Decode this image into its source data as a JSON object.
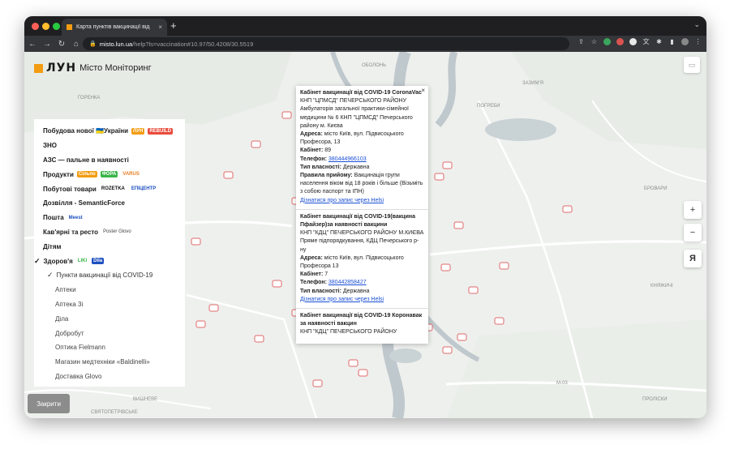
{
  "browser": {
    "tab_title": "Карта пунктів вакцинації від",
    "tab_close": "×",
    "new_tab": "+",
    "url_host": "misto.lun.ua",
    "url_path": "/help?ls=vaccination#10.97/50.4208/30.5519"
  },
  "brand": {
    "lun": "ЛУН",
    "name": "Місто Моніторинг"
  },
  "map_labels": {
    "horenka": "ГОРЕНКА",
    "obolon": "ОБОЛОНЬ",
    "zazymia": "ЗАЗИМ'Я",
    "pohreby": "ПОГРЕБИ",
    "brovary": "БРОВАРИ",
    "kniazhychi": "КНЯЖИЧІ",
    "vyshneve": "ВИШНЕВЕ",
    "sviatopetrivske": "СВЯТОПЕТРІВСЬКЕ",
    "proliski": "ПРОЛІСКИ",
    "m03": "М-03"
  },
  "menu": {
    "items": [
      {
        "label": "Побудова нової 🇺🇦України",
        "extra": "ЛУН"
      },
      {
        "label": "ЗНО"
      },
      {
        "label": "АЗС — пальне в наявності"
      },
      {
        "label": "Продукти",
        "extra": "VARUS"
      },
      {
        "label": "Побутові товари",
        "extra": "ROZETKA"
      },
      {
        "label": "Дозвілля - SemanticForce"
      },
      {
        "label": "Пошта"
      },
      {
        "label": "Кав'ярні та ресто",
        "extra": "Poster Glovo"
      },
      {
        "label": "Дітям"
      },
      {
        "label": "Здоров'я"
      }
    ],
    "selected_sub": "Пункти вакцинації від COVID-19",
    "subitems": [
      "Аптеки",
      "Аптека 3і",
      "Діла",
      "Добробут",
      "Оптика Fielmann",
      "Магазин медтехніки «Baldinelli»",
      "Доставка Glovo"
    ],
    "checkmark": "✓",
    "close_button": "Закрити",
    "chips": {
      "lun_rebuild": "REBUILD",
      "store1": "Сільпо",
      "store2": "ФОРА",
      "epicenter": "ЕПІЦЕНТР",
      "meest": "Meest",
      "liki": "LIKI",
      "dila": "Dila"
    }
  },
  "popup": {
    "close": "×",
    "cards": [
      {
        "title": "Кабінет вакцинації від COVID-19 CoronaVac",
        "body": "КНП \"ЦПМСД\" ПЕЧЕРСЬКОГО РАЙОНУ Амбулаторія загальної практики-сімейної медицини № 6 КНП \"ЦПМСД\" Печерського району м. Києва",
        "address_label": "Адреса:",
        "address": "місто Київ, вул. Підвисоцького Професора, 13",
        "cabinet_label": "Кабінет:",
        "cabinet": "89",
        "phone_label": "Телефон:",
        "phone": "380444966103",
        "ownership_label": "Тип власності:",
        "ownership": "Державна",
        "rules_label": "Правила прийому:",
        "rules": "Вакцинація групи населення віком від 18 років і більше (Візьміть з собою паспорт та ІПН)",
        "link": "Дізнатися про запис через Helsi"
      },
      {
        "title": "Кабінет вакцинації від COVID-19(вакцина Пфайзер)за наявності вакцини",
        "body": "КНП \"КДЦ\" ПЕЧЕРСЬКОГО РАЙОНУ М.КИЄВА Пряме підпорядкування, КДЦ Печерського р-ну",
        "address_label": "Адреса:",
        "address": "місто Київ, вул. Підвисоцького Професора 13",
        "cabinet_label": "Кабінет:",
        "cabinet": "7",
        "phone_label": "Телефон:",
        "phone": "380442858427",
        "ownership_label": "Тип власності:",
        "ownership": "Державна",
        "link": "Дізнатися про запис через Helsi"
      },
      {
        "title": "Кабінет вакцинації від COVID-19 Коронавак за наявності вакцин",
        "body": "КНП \"КДЦ\" ПЕЧЕРСЬКОГО РАЙОНУ"
      }
    ]
  },
  "controls": {
    "zoom_in": "+",
    "zoom_out": "−",
    "lang": "Я"
  },
  "colors": {
    "accent": "#f39c12",
    "link": "#1a4fd6",
    "river": "#bfc8cc",
    "marker": "#e06a6a"
  }
}
